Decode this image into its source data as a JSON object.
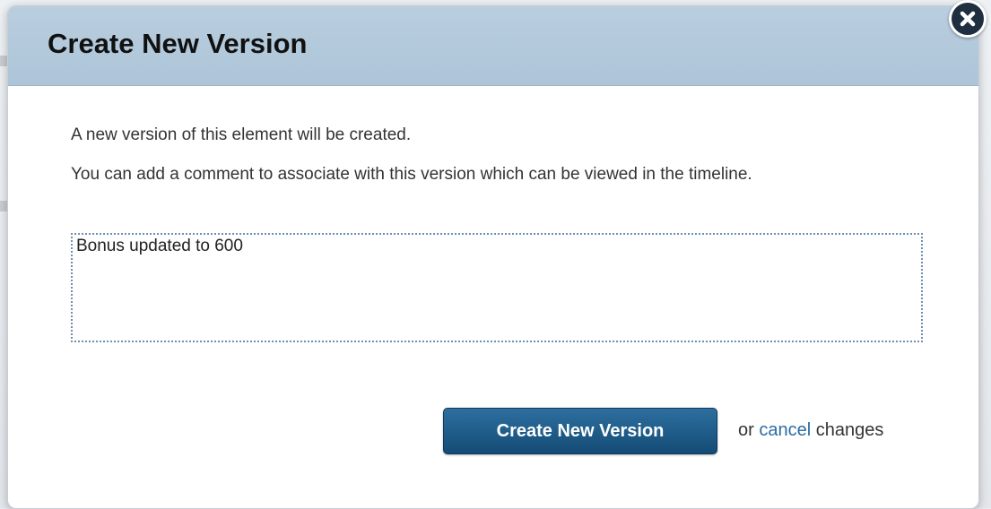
{
  "dialog": {
    "title": "Create New Version",
    "message_1": "A new version of this element will be created.",
    "message_2": "You can add a comment to associate with this version which can be viewed in the timeline.",
    "comment_value": "Bonus updated to 600",
    "primary_button_label": "Create New Version",
    "cancel_prefix": "or ",
    "cancel_link": "cancel",
    "cancel_suffix": " changes",
    "close_icon": "close-icon"
  },
  "colors": {
    "header_bg": "#b0c7d9",
    "primary_button": "#1d5a88",
    "link": "#2b6ca3",
    "close_button": "#1f2f40"
  }
}
